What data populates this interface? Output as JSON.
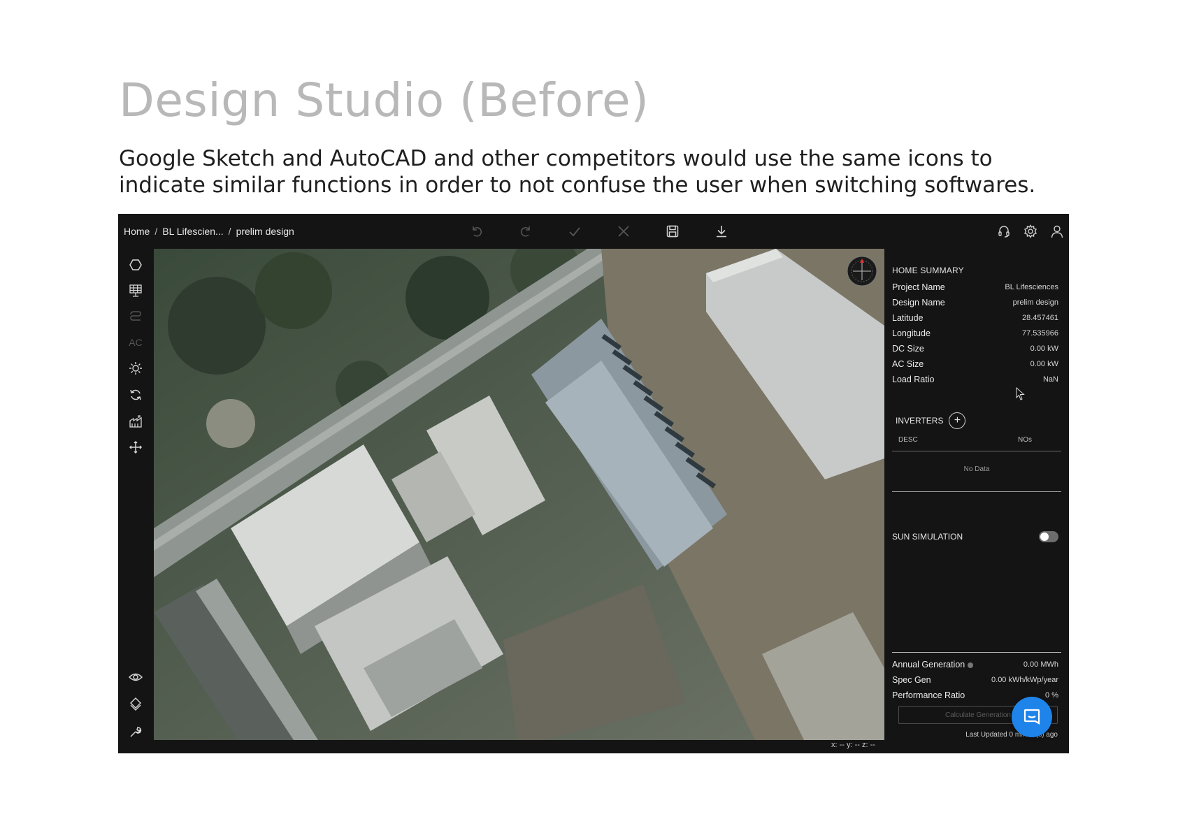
{
  "slide": {
    "title": "Design Studio (Before)",
    "subtitle": "Google Sketch and AutoCAD and other competitors would use the same icons to indicate similar functions in order to not confuse the user when switching softwares."
  },
  "app": {
    "breadcrumb": [
      "Home",
      "BL Lifescien...",
      "prelim design"
    ],
    "breadcrumb_separator": "/",
    "toolbar": [
      "undo-icon",
      "redo-icon",
      "confirm-icon",
      "cancel-icon",
      "save-icon",
      "download-icon"
    ],
    "top_right": [
      "support-icon",
      "settings-icon",
      "user-icon"
    ],
    "left_tools": [
      {
        "icon": "polygon-icon"
      },
      {
        "icon": "solar-panel-icon"
      },
      {
        "icon": "wiring-icon"
      },
      {
        "icon": "ac-label",
        "label": "AC"
      },
      {
        "icon": "sun-icon"
      },
      {
        "icon": "refresh-icon"
      },
      {
        "icon": "factory-icon"
      },
      {
        "icon": "move-icon"
      },
      {
        "icon": "eye-icon"
      },
      {
        "icon": "layers-icon"
      },
      {
        "icon": "wrench-icon"
      }
    ],
    "coords": "x: -- y: -- z: --",
    "colors": {
      "accent": "#1e84ea",
      "background": "#141414",
      "text": "#e6e6e6"
    }
  },
  "panel": {
    "header": "HOME SUMMARY",
    "summary": [
      {
        "key": "Project Name",
        "value": "BL Lifesciences"
      },
      {
        "key": "Design Name",
        "value": "prelim design"
      },
      {
        "key": "Latitude",
        "value": "28.457461"
      },
      {
        "key": "Longitude",
        "value": "77.535966"
      },
      {
        "key": "DC Size",
        "value": "0.00 kW"
      },
      {
        "key": "AC Size",
        "value": "0.00 kW"
      },
      {
        "key": "Load Ratio",
        "value": "NaN"
      }
    ],
    "inverters": {
      "header": "INVERTERS",
      "columns": [
        "DESC",
        "NOs"
      ],
      "empty": "No Data"
    },
    "sun_simulation": {
      "label": "SUN SIMULATION",
      "enabled": false
    },
    "generation": [
      {
        "key": "Annual Generation",
        "value": "0.00 MWh"
      },
      {
        "key": "Spec Gen",
        "value": "0.00 kWh/kWp/year"
      },
      {
        "key": "Performance Ratio",
        "value": "0 %"
      }
    ],
    "calculate_button": "Calculate Generation",
    "last_updated": "Last Updated 0 minute(s) ago"
  }
}
